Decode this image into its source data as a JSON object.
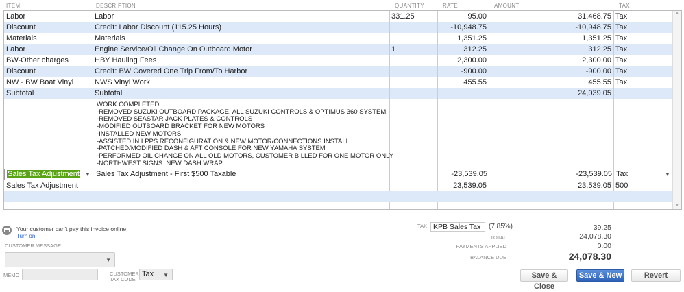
{
  "columns": {
    "item": "ITEM",
    "description": "DESCRIPTION",
    "quantity": "QUANTITY",
    "rate": "RATE",
    "amount": "AMOUNT",
    "tax": "TAX"
  },
  "rows": [
    {
      "item": "Labor",
      "description": "Labor",
      "quantity": "331.25",
      "rate": "95.00",
      "amount": "31,468.75",
      "tax": "Tax"
    },
    {
      "item": "Discount",
      "description": "Credit: Labor Discount (115.25 Hours)",
      "quantity": "",
      "rate": "-10,948.75",
      "amount": "-10,948.75",
      "tax": "Tax"
    },
    {
      "item": "Materials",
      "description": "Materials",
      "quantity": "",
      "rate": "1,351.25",
      "amount": "1,351.25",
      "tax": "Tax"
    },
    {
      "item": "Labor",
      "description": "Engine Service/Oil Change On Outboard Motor",
      "quantity": "1",
      "rate": "312.25",
      "amount": "312.25",
      "tax": "Tax"
    },
    {
      "item": "BW-Other charges",
      "description": "HBY Hauling Fees",
      "quantity": "",
      "rate": "2,300.00",
      "amount": "2,300.00",
      "tax": "Tax"
    },
    {
      "item": "Discount",
      "description": "Credit: BW Covered One Trip From/To Harbor",
      "quantity": "",
      "rate": "-900.00",
      "amount": "-900.00",
      "tax": "Tax"
    },
    {
      "item": "NW - BW Boat Vinyl",
      "description": "NWS Vinyl Work",
      "quantity": "",
      "rate": "455.55",
      "amount": "455.55",
      "tax": "Tax"
    },
    {
      "item": "Subtotal",
      "description": "Subtotal",
      "quantity": "",
      "rate": "",
      "amount": "24,039.05",
      "tax": ""
    }
  ],
  "memo_text": "WORK COMPLETED:\n-REMOVED SUZUKI OUTBOARD PACKAGE, ALL SUZUKI CONTROLS & OPTIMUS 360 SYSTEM\n-REMOVED SEASTAR JACK PLATES & CONTROLS\n-MODIFIED OUTBOARD BRACKET FOR NEW MOTORS\n-INSTALLED NEW MOTORS\n-ASSISTED IN LPPS RECONFIGURATION & NEW MOTOR/CONNECTIONS INSTALL\n-PATCHED/MODIFIED DASH & AFT CONSOLE FOR NEW YAMAHA SYSTEM\n-PERFORMED OIL CHANGE ON ALL OLD MOTORS, CUSTOMER BILLED FOR ONE MOTOR ONLY\n-NORTHWEST SIGNS: NEW DASH WRAP",
  "selected_row": {
    "item": "Sales Tax Adjustment",
    "description": "Sales Tax Adjustment - First $500 Taxable",
    "rate": "-23,539.05",
    "amount": "-23,539.05",
    "tax": "Tax"
  },
  "row_after": {
    "item": "Sales Tax Adjustment",
    "rate": "23,539.05",
    "amount": "23,539.05",
    "tax": "500"
  },
  "online": {
    "message": "Your customer can't pay this invoice online",
    "link": "Turn on"
  },
  "customer_message_label": "CUSTOMER MESSAGE",
  "memo_label": "MEMO",
  "customer_tax_code_label": "CUSTOMER TAX CODE",
  "customer_tax_code": "Tax",
  "totals": {
    "tax_label": "TAX",
    "tax_item": "KPB Sales Tax",
    "tax_rate": "(7.85%)",
    "tax_amount": "39.25",
    "total_label": "TOTAL",
    "total": "24,078.30",
    "payments_label": "PAYMENTS APPLIED",
    "payments": "0.00",
    "balance_label": "BALANCE DUE",
    "balance": "24,078.30"
  },
  "buttons": {
    "save_close": "Save & Close",
    "save_new": "Save & New",
    "revert": "Revert"
  },
  "colors": {
    "row_alt": "#dde9f8",
    "selection": "#5aa317",
    "primary": "#3a6fc4"
  }
}
